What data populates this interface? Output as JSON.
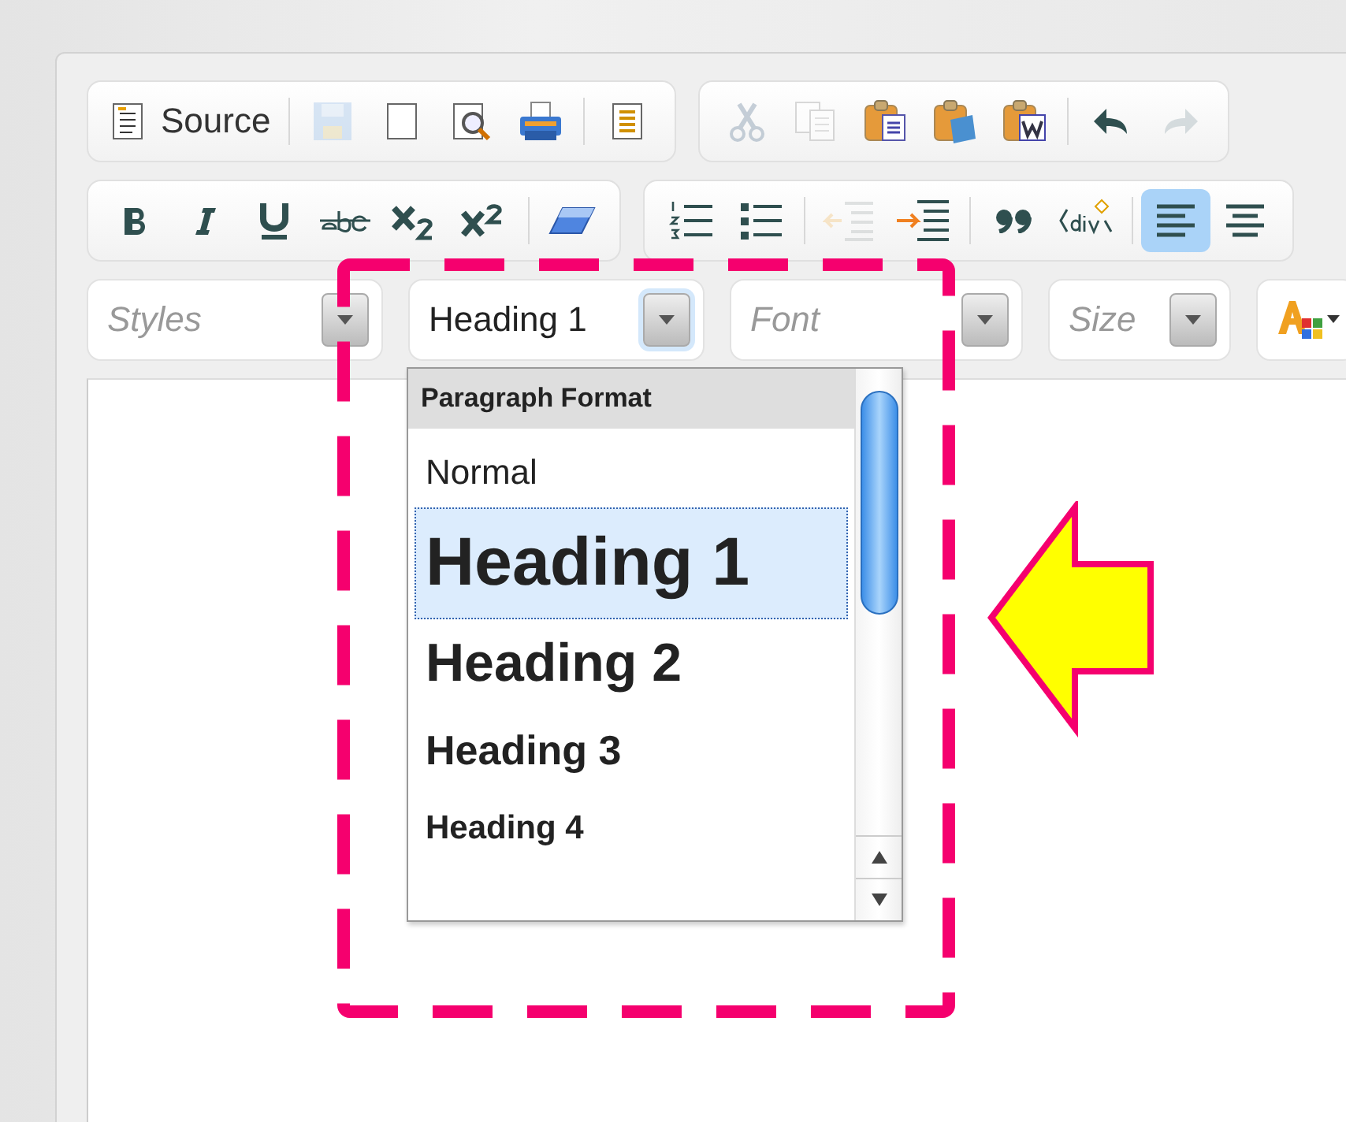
{
  "toolbar_rows": [
    [
      {
        "buttons": [
          {
            "kind": "source",
            "label": "Source",
            "disabled": false
          },
          {
            "kind": "separator"
          },
          {
            "kind": "save",
            "disabled": true
          },
          {
            "kind": "newpage",
            "disabled": false
          },
          {
            "kind": "preview",
            "disabled": false
          },
          {
            "kind": "print",
            "disabled": false
          },
          {
            "kind": "separator"
          },
          {
            "kind": "templates",
            "disabled": false
          }
        ]
      },
      {
        "buttons": [
          {
            "kind": "cut",
            "disabled": true
          },
          {
            "kind": "copy",
            "disabled": true
          },
          {
            "kind": "paste",
            "disabled": false
          },
          {
            "kind": "pastetext",
            "disabled": false
          },
          {
            "kind": "pasteword",
            "disabled": false
          },
          {
            "kind": "separator"
          },
          {
            "kind": "undo",
            "disabled": false
          },
          {
            "kind": "redo",
            "disabled": true
          }
        ]
      }
    ],
    [
      {
        "buttons": [
          {
            "kind": "bold",
            "disabled": false,
            "on": false
          },
          {
            "kind": "italic",
            "disabled": false,
            "on": false
          },
          {
            "kind": "underline",
            "disabled": false,
            "on": false
          },
          {
            "kind": "strike",
            "disabled": false,
            "on": false
          },
          {
            "kind": "subscript",
            "disabled": false,
            "on": false
          },
          {
            "kind": "superscript",
            "disabled": false,
            "on": false
          },
          {
            "kind": "separator"
          },
          {
            "kind": "eraser",
            "disabled": false,
            "on": false
          }
        ]
      },
      {
        "buttons": [
          {
            "kind": "numlist",
            "disabled": false,
            "on": false
          },
          {
            "kind": "bullist",
            "disabled": false,
            "on": false
          },
          {
            "kind": "separator"
          },
          {
            "kind": "outdent",
            "disabled": true,
            "on": false
          },
          {
            "kind": "indent",
            "disabled": false,
            "on": false
          },
          {
            "kind": "separator"
          },
          {
            "kind": "blockquote",
            "disabled": false,
            "on": false
          },
          {
            "kind": "div",
            "disabled": false,
            "on": false
          },
          {
            "kind": "separator"
          },
          {
            "kind": "alignleft",
            "disabled": false,
            "on": true
          },
          {
            "kind": "aligncenter",
            "disabled": false,
            "on": false
          }
        ]
      }
    ]
  ],
  "combos": [
    {
      "placeholder": "Styles",
      "open": false
    },
    {
      "value": "Heading 1",
      "open": true
    },
    {
      "placeholder": "Font",
      "open": false
    },
    {
      "placeholder": "Size",
      "open": false
    }
  ],
  "format_panel": {
    "title": "Paragraph Format",
    "items": [
      {
        "kind": "normal",
        "label": "Normal",
        "selected": false
      },
      {
        "kind": "h1",
        "label": "Heading 1",
        "selected": true
      },
      {
        "kind": "h2",
        "label": "Heading 2",
        "selected": false
      },
      {
        "kind": "h3",
        "label": "Heading 3",
        "selected": false
      },
      {
        "kind": "h4",
        "label": "Heading 4",
        "selected": false
      }
    ]
  }
}
